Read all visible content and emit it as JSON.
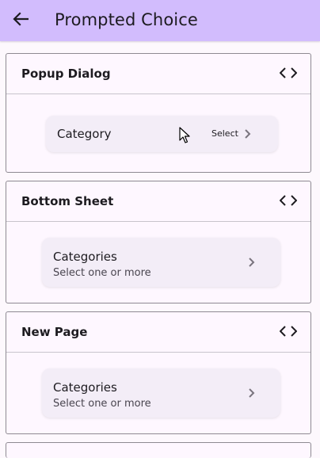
{
  "appbar": {
    "title": "Prompted Choice",
    "back_icon": "arrow-left-icon"
  },
  "colors": {
    "appbar": "#d2bcfd",
    "background": "#fdf8fd",
    "tile": "#f3edf7"
  },
  "cards": [
    {
      "title": "Popup Dialog",
      "code_icon": "code-icon",
      "tile": {
        "label": "Category",
        "trailing": "Select"
      }
    },
    {
      "title": "Bottom Sheet",
      "code_icon": "code-icon",
      "tile": {
        "label": "Categories",
        "subtitle": "Select one or more"
      }
    },
    {
      "title": "New Page",
      "code_icon": "code-icon",
      "tile": {
        "label": "Categories",
        "subtitle": "Select one or more"
      }
    }
  ]
}
